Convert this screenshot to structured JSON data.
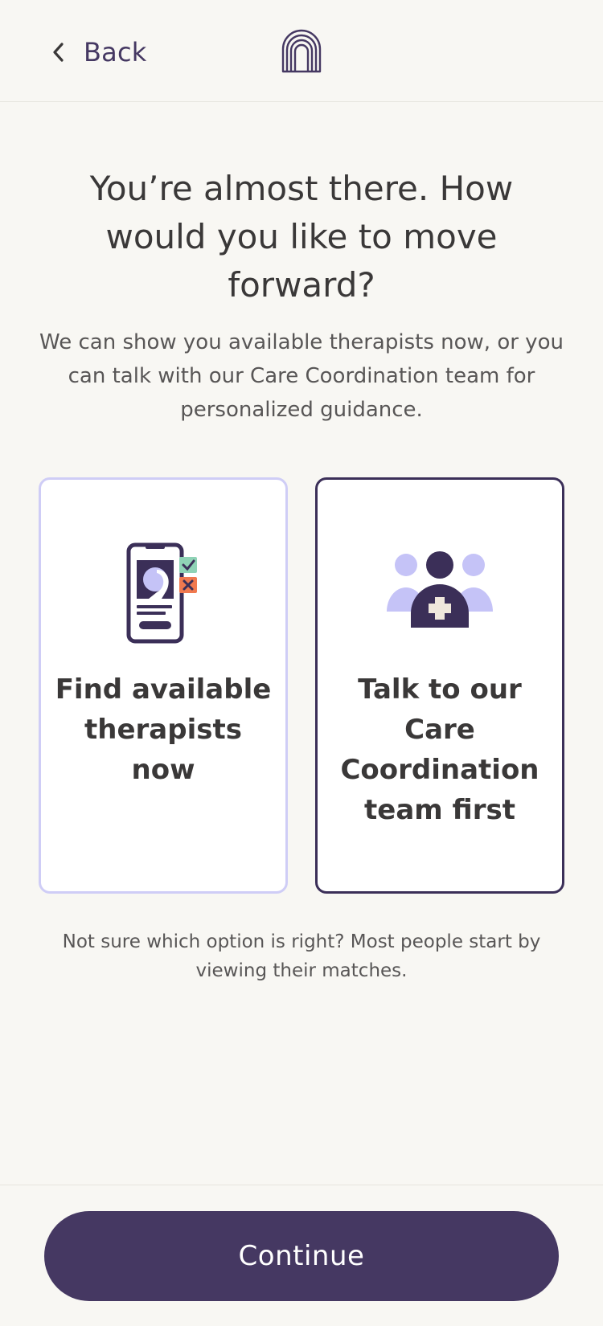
{
  "header": {
    "back_label": "Back",
    "back_icon": "chevron-left-icon",
    "logo_icon": "arch-logo-icon"
  },
  "main": {
    "title": "You’re almost there. How would you like to move forward?",
    "subtitle": "We can show you available therapists now, or you can talk with our Care Coordination team for personalized guidance.",
    "options": [
      {
        "label": "Find available therapists now",
        "icon": "phone-match-icon",
        "selected": false
      },
      {
        "label": "Talk to our Care Coordination team first",
        "icon": "care-team-icon",
        "selected": true
      }
    ],
    "hint": "Not sure which option is right? Most people start by viewing their matches."
  },
  "footer": {
    "continue_label": "Continue"
  },
  "colors": {
    "background": "#f8f7f3",
    "primary": "#453862",
    "card_border_unselected": "#cfcdf6",
    "card_border_selected": "#3b2f58",
    "text": "#3a3838",
    "icon_lavender": "#c5c3f7",
    "icon_check": "#8fd3b6",
    "icon_cross": "#f0794f"
  }
}
